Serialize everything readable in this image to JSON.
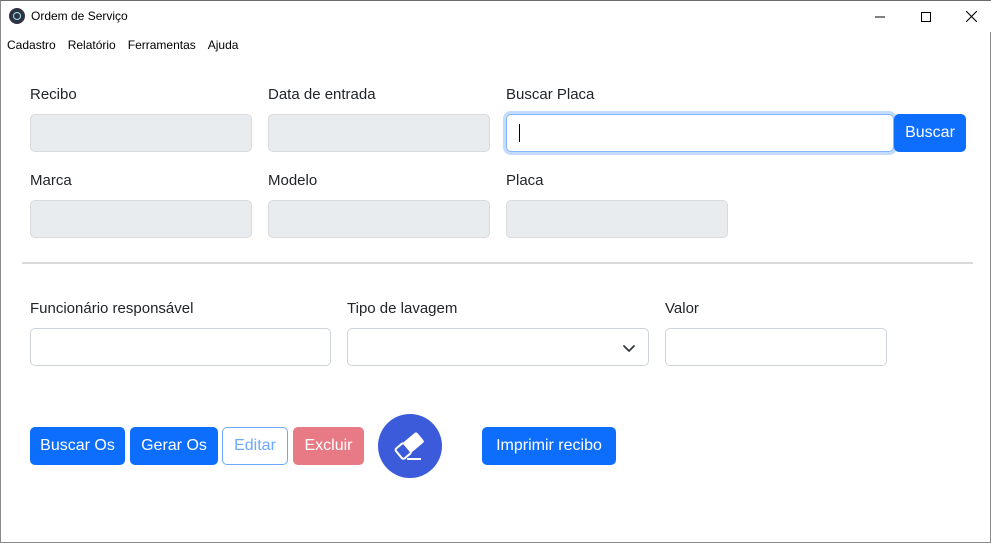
{
  "window": {
    "title": "Ordem de Serviço",
    "minimize_glyph": "—",
    "maximize_glyph": "☐",
    "close_glyph": "✕"
  },
  "menu": [
    "Cadastro",
    "Relatório",
    "Ferramentas",
    "Ajuda"
  ],
  "form": {
    "recibo": {
      "label": "Recibo",
      "value": ""
    },
    "data_entrada": {
      "label": "Data de entrada",
      "value": ""
    },
    "buscar_placa": {
      "label": "Buscar Placa",
      "value": "",
      "button": "Buscar"
    },
    "marca": {
      "label": "Marca",
      "value": ""
    },
    "modelo": {
      "label": "Modelo",
      "value": ""
    },
    "placa": {
      "label": "Placa",
      "value": ""
    },
    "funcionario": {
      "label": "Funcionário responsável",
      "value": ""
    },
    "tipo_lavagem": {
      "label": "Tipo de lavagem",
      "selected": ""
    },
    "valor": {
      "label": "Valor",
      "value": ""
    }
  },
  "actions": {
    "buscar_os": "Buscar Os",
    "gerar_os": "Gerar Os",
    "editar": "Editar",
    "excluir": "Excluir",
    "clear_icon": "eraser-icon",
    "imprimir": "Imprimir recibo"
  },
  "colors": {
    "primary": "#0d6efd",
    "danger_disabled": "#e77a84",
    "round_button": "#3b5bdb",
    "readonly_bg": "#e9ecef"
  }
}
